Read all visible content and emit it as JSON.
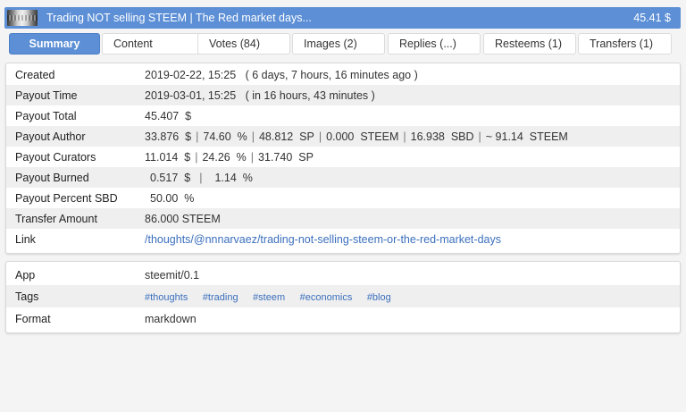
{
  "header": {
    "title": "Trading NOT selling STEEM | The Red market days...",
    "amount": "45.41 $"
  },
  "tabs": [
    {
      "label": "Summary",
      "active": true
    },
    {
      "label": "Content"
    },
    {
      "label": "Votes (84)"
    },
    {
      "label": "Images (2)"
    },
    {
      "label": "Replies (...)"
    },
    {
      "label": "Resteems (1)"
    },
    {
      "label": "Transfers (1)"
    }
  ],
  "summary": {
    "created": {
      "label": "Created",
      "value": "2019-02-22, 15:25",
      "relative": "( 6 days, 7 hours, 16 minutes ago )"
    },
    "payout_time": {
      "label": "Payout Time",
      "value": "2019-03-01, 15:25",
      "relative": "( in 16 hours, 43 minutes )"
    },
    "payout_total": {
      "label": "Payout Total",
      "value": "45.407  $"
    },
    "payout_author": {
      "label": "Payout Author",
      "parts": [
        "33.876  $",
        "74.60  %",
        "48.812  SP",
        "0.000  STEEM",
        "16.938  SBD",
        "~ 91.14  STEEM"
      ]
    },
    "payout_curators": {
      "label": "Payout Curators",
      "parts": [
        "11.014  $",
        "24.26  %",
        "31.740  SP"
      ]
    },
    "payout_burned": {
      "label": "Payout Burned",
      "parts": [
        "0.517  $",
        "1.14  %"
      ]
    },
    "payout_percent_sbd": {
      "label": "Payout Percent SBD",
      "value": "50.00  %"
    },
    "transfer_amount": {
      "label": "Transfer Amount",
      "value": "86.000 STEEM"
    },
    "link": {
      "label": "Link",
      "value": "/thoughts/@nnnarvaez/trading-not-selling-steem-or-the-red-market-days"
    }
  },
  "meta": {
    "app": {
      "label": "App",
      "value": "steemit/0.1"
    },
    "tags": {
      "label": "Tags",
      "values": [
        "#thoughts",
        "#trading",
        "#steem",
        "#economics",
        "#blog"
      ]
    },
    "format": {
      "label": "Format",
      "value": "markdown"
    }
  },
  "colors": {
    "accent": "#5c8fd6",
    "link": "#3b6fbd",
    "row_alt": "#efefef"
  },
  "icons": {
    "thumbnail": "post-thumbnail-image"
  }
}
